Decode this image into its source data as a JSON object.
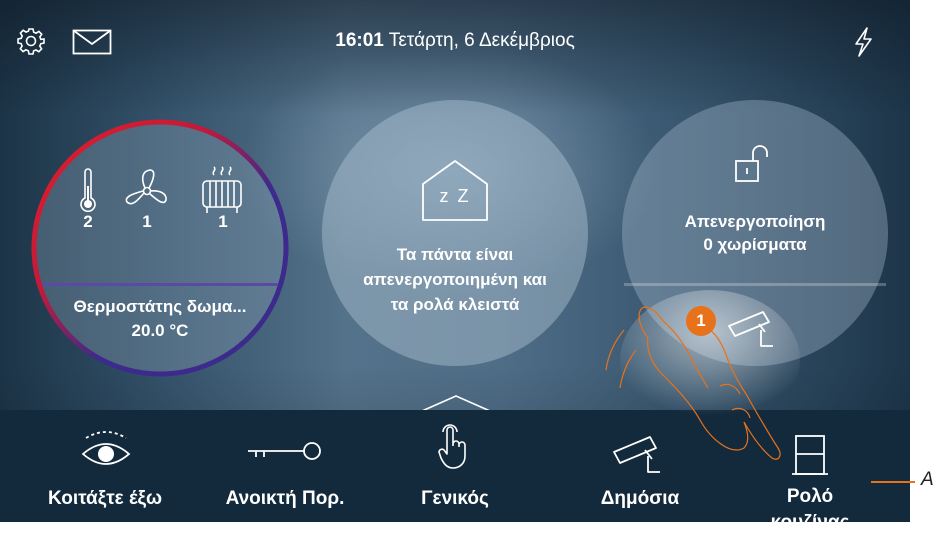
{
  "status_bar": {
    "time": "16:01",
    "date": "Τετάρτη, 6 Δεκέμβριος",
    "icons": [
      "gear-icon",
      "mail-icon",
      "bolt-icon"
    ]
  },
  "thermostat": {
    "counts": {
      "thermometer": "2",
      "fan": "1",
      "radiator": "1"
    },
    "name": "Θερμοστάτης δωμα...",
    "temperature": "20.0 °C",
    "ring_colors": [
      "#e21e2b",
      "#3c2a8c"
    ]
  },
  "night_scene": {
    "icon_text": "z Z",
    "line1": "Τα πάντα είναι",
    "line2": "απενεργοποιημένη και",
    "line3": "τα ρολά κλειστά"
  },
  "alarm": {
    "line1": "Απενεργοποίηση",
    "line2": "0 χωρίσματα"
  },
  "bottom_bar": {
    "items": [
      {
        "label": "Κοιτάξτε έξω",
        "icon": "eye-icon"
      },
      {
        "label": "Ανοικτή Πορ.",
        "icon": "key-icon"
      },
      {
        "label": "Γενικός",
        "icon": "hand-touch-icon"
      },
      {
        "label": "Δημόσια",
        "icon": "camera-icon"
      },
      {
        "label_line1": "Ρολό",
        "label_line2": "κουζίνας",
        "icon": "blind-icon"
      }
    ]
  },
  "annotation": {
    "marker": "1",
    "callout": "A",
    "accent": "#e8721c"
  }
}
